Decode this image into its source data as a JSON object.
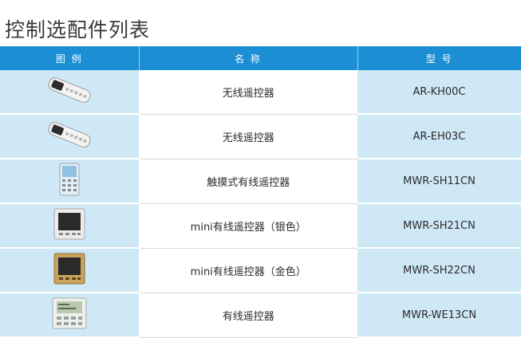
{
  "title": "控制选配件列表",
  "table": {
    "headers": [
      "图 例",
      "名 称",
      "型 号"
    ],
    "rows": [
      {
        "name": "无线遥控器",
        "model": "AR-KH00C",
        "icon": "wireless-remote-icon"
      },
      {
        "name": "无线遥控器",
        "model": "AR-EH03C",
        "icon": "wireless-remote-icon"
      },
      {
        "name": "触摸式有线遥控器",
        "model": "MWR-SH11CN",
        "icon": "touch-wired-controller-icon"
      },
      {
        "name": "mini有线遥控器（银色）",
        "model": "MWR-SH21CN",
        "icon": "mini-wired-controller-silver-icon"
      },
      {
        "name": "mini有线遥控器（金色）",
        "model": "MWR-SH22CN",
        "icon": "mini-wired-controller-gold-icon"
      },
      {
        "name": "有线遥控器",
        "model": "MWR-WE13CN",
        "icon": "wired-controller-icon"
      }
    ]
  },
  "colors": {
    "header_bg": "#1c8fd4",
    "cell_bg": "#cfe8f6"
  }
}
